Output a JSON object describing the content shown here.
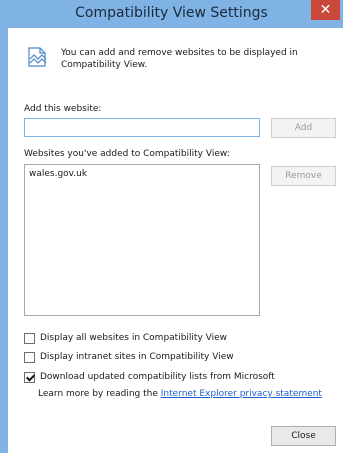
{
  "window": {
    "title": "Compatibility View Settings",
    "close_glyph": "✕"
  },
  "info": {
    "icon": "compatibility-view-icon",
    "text": "You can add and remove websites to be displayed in Compatibility View."
  },
  "add_site": {
    "label": "Add this website:",
    "value": "",
    "placeholder": "",
    "button_label": "Add"
  },
  "sites": {
    "label": "Websites you've added to Compatibility View:",
    "items": [
      "wales.gov.uk"
    ],
    "remove_label": "Remove"
  },
  "options": [
    {
      "label": "Display all websites in Compatibility View",
      "checked": false
    },
    {
      "label": "Display intranet sites in Compatibility View",
      "checked": false
    },
    {
      "label": "Download updated compatibility lists from Microsoft",
      "checked": true
    }
  ],
  "learn_more": {
    "prefix": "Learn more by reading the ",
    "link": "Internet Explorer privacy statement"
  },
  "close_label": "Close",
  "colors": {
    "titlebar": "#7fb2e5",
    "close_button": "#c9483a",
    "link": "#1a5fd1"
  }
}
